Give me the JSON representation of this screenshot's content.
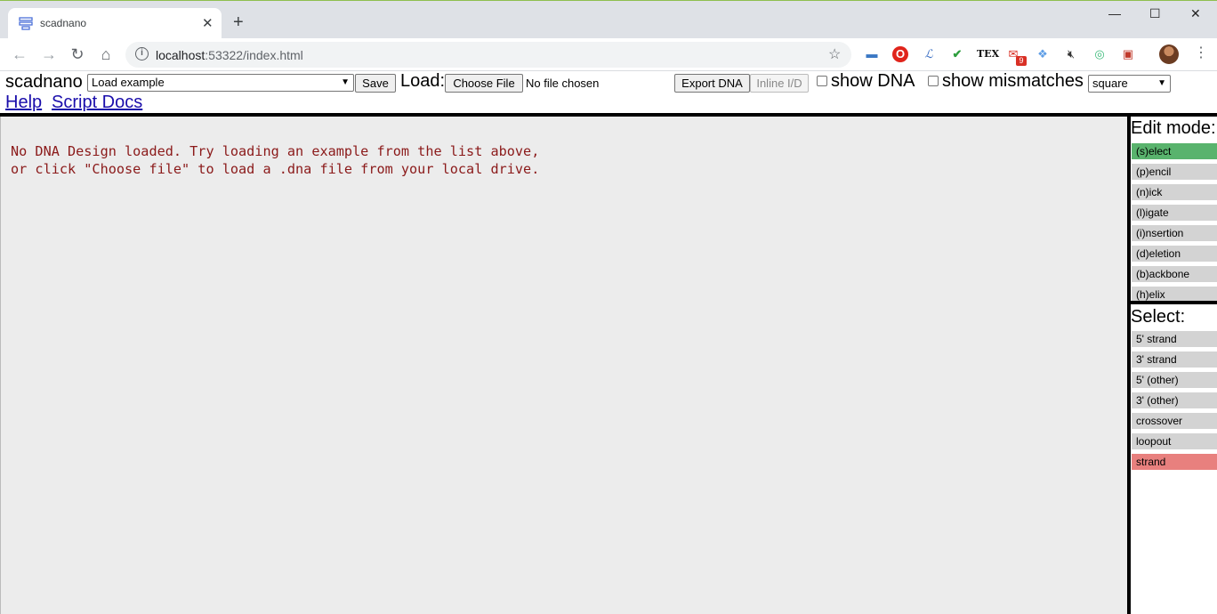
{
  "browser": {
    "tab_title": "scadnano",
    "url_host": "localhost",
    "url_port_path": ":53322/index.html",
    "extension_badge": "9",
    "extension_tex": "TEX",
    "window_minimize": "—",
    "window_maximize": "☐",
    "window_close": "✕"
  },
  "header": {
    "app_name": "scadnano",
    "load_example_select": "Load example",
    "save_label": "Save",
    "load_label": "Load:",
    "choose_file_label": "Choose File",
    "file_status": "No file chosen",
    "export_dna_label": "Export DNA",
    "inline_id_label": "Inline I/D",
    "show_dna_label": "show DNA",
    "show_mismatches_label": "show mismatches",
    "grid_select": "square",
    "help_link": "Help",
    "script_docs_link": "Script Docs"
  },
  "main": {
    "message_line1": "No DNA Design loaded. Try loading an example from the list above,",
    "message_line2": "or click \"Choose file\" to load a .dna file from your local drive."
  },
  "side": {
    "edit_mode_title": "Edit mode:",
    "edit_modes": [
      "(s)elect",
      "(p)encil",
      "(n)ick",
      "(l)igate",
      "(i)nsertion",
      "(d)eletion",
      "(b)ackbone",
      "(h)elix"
    ],
    "select_title": "Select:",
    "select_items": [
      "5' strand",
      "3' strand",
      "5' (other)",
      "3' (other)",
      "crossover",
      "loopout",
      "strand"
    ]
  },
  "colors": {
    "active_mode": "#59b36d",
    "strand_selected": "#e8807e",
    "message_text": "#8b1a1a"
  }
}
